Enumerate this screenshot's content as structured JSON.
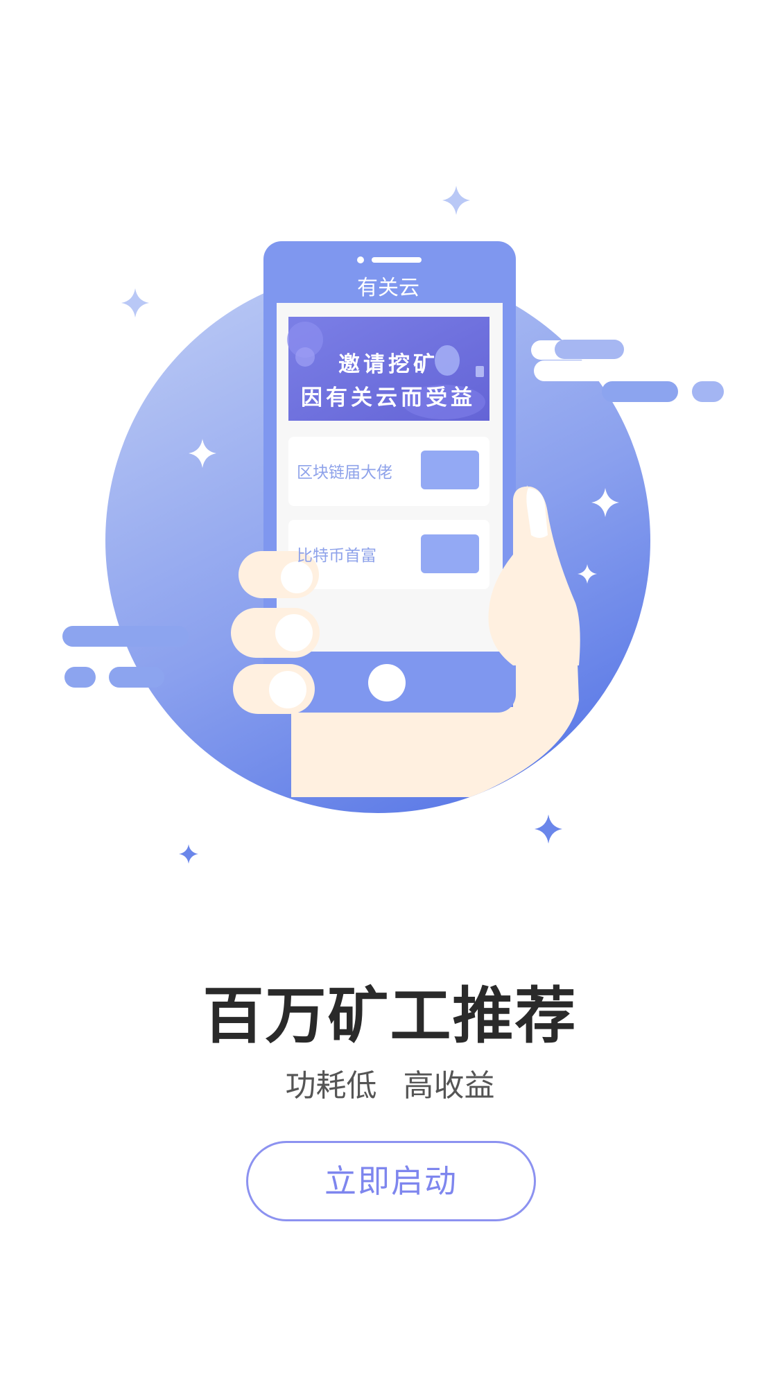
{
  "illustration": {
    "phone_app_name": "有关云",
    "banner_line1": "邀请挖矿",
    "banner_line2": "因有关云而受益",
    "cards": [
      {
        "label": "区块链届大佬"
      },
      {
        "label": "比特币首富"
      }
    ],
    "colors": {
      "circle_top": "#b5c4f3",
      "circle_bottom": "#5a79e6",
      "phone_body": "#7e95ef",
      "banner": "#6f71dd",
      "card_button": "#93a9f4",
      "hand": "#fff0e0"
    }
  },
  "headline": "百万矿工推荐",
  "subline": {
    "part1": "功耗低",
    "part2": "高收益"
  },
  "start_button_label": "立即启动",
  "accent_color": "#7e86ee"
}
